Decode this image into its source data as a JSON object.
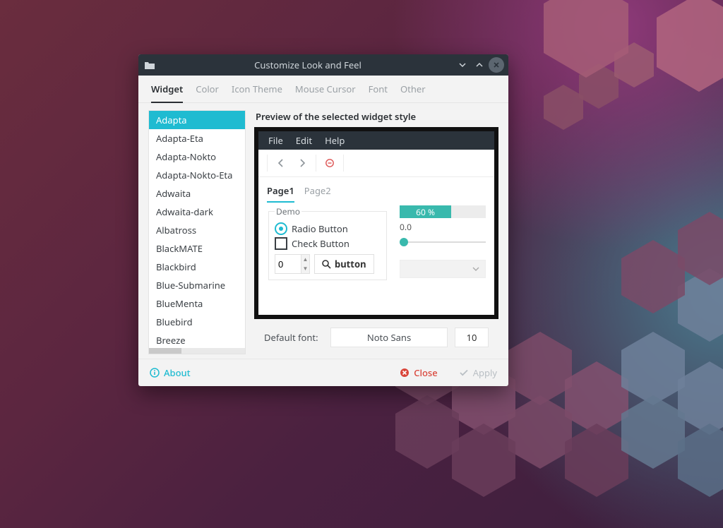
{
  "window": {
    "title": "Customize Look and Feel"
  },
  "tabs": [
    "Widget",
    "Color",
    "Icon Theme",
    "Mouse Cursor",
    "Font",
    "Other"
  ],
  "active_tab": 0,
  "widget_list": [
    "Adapta",
    "Adapta-Eta",
    "Adapta-Nokto",
    "Adapta-Nokto-Eta",
    "Adwaita",
    "Adwaita-dark",
    "Albatross",
    "BlackMATE",
    "Blackbird",
    "Blue-Submarine",
    "BlueMenta",
    "Bluebird",
    "Breeze"
  ],
  "selected_widget": 0,
  "preview": {
    "label": "Preview of the selected widget style",
    "menus": [
      "File",
      "Edit",
      "Help"
    ],
    "page_tabs": [
      "Page1",
      "Page2"
    ],
    "active_page": 0,
    "demo_frame": "Demo",
    "radio_label": "Radio Button",
    "check_label": "Check Button",
    "spin_value": "0",
    "search_button": "button",
    "progress_pct": 60,
    "progress_text": "60 %",
    "slider_label": "0.0"
  },
  "font": {
    "label": "Default font:",
    "family": "Noto Sans",
    "size": "10"
  },
  "footer": {
    "about": "About",
    "close": "Close",
    "apply": "Apply"
  },
  "colors": {
    "accent": "#1fbbd1",
    "teal": "#39b9ad"
  }
}
